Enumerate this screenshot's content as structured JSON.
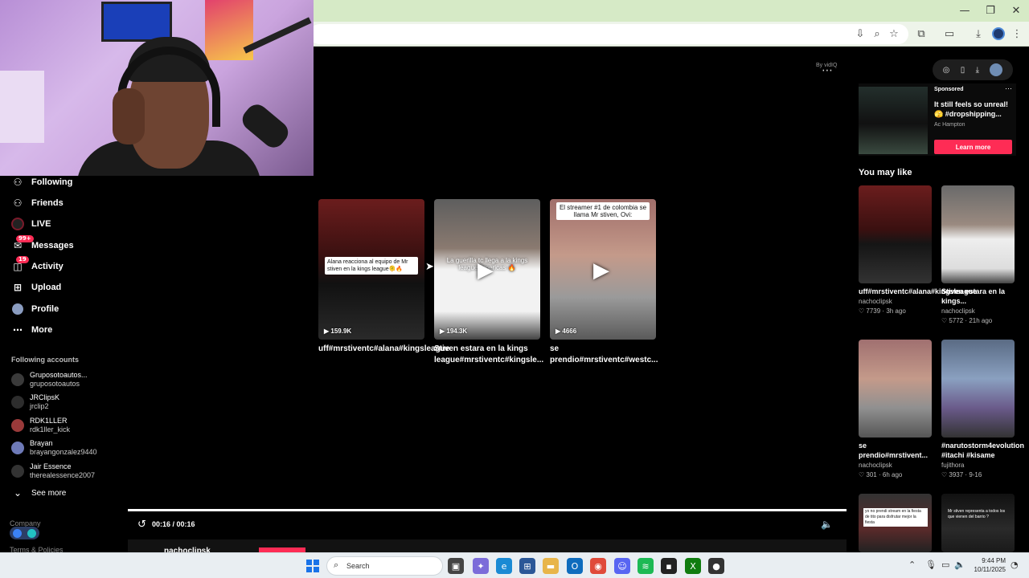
{
  "browser": {
    "window_controls": [
      "—",
      "❐",
      "✕"
    ],
    "toolbar_icons": [
      "install-icon",
      "zoom-icon",
      "star-icon",
      "extensions-icon",
      "cast-icon",
      "download-icon",
      "profile-icon",
      "menu-icon"
    ]
  },
  "sidebar": {
    "nav": [
      {
        "label": "Following",
        "icon": "following-icon"
      },
      {
        "label": "Friends",
        "icon": "friends-icon"
      },
      {
        "label": "LIVE",
        "icon": "live-icon"
      },
      {
        "label": "Messages",
        "icon": "messages-icon",
        "badge": "99+"
      },
      {
        "label": "Activity",
        "icon": "activity-icon",
        "badge": "19"
      },
      {
        "label": "Upload",
        "icon": "upload-icon"
      },
      {
        "label": "Profile",
        "icon": "profile-avatar"
      },
      {
        "label": "More",
        "icon": "more-icon"
      }
    ],
    "following_title": "Following accounts",
    "accounts": [
      {
        "name": "Gruposotoautos...",
        "handle": "gruposotoautos"
      },
      {
        "name": "JRClipsK",
        "handle": "jrclip2"
      },
      {
        "name": "RDK1LLER",
        "handle": "rdk1ller_kick"
      },
      {
        "name": "Brayan",
        "handle": "brayangonzalez9440"
      },
      {
        "name": "Jair Essence",
        "handle": "therealessence2007"
      }
    ],
    "see_more": "See more",
    "footer": {
      "company": "Company",
      "terms": "Terms & Policies"
    }
  },
  "main": {
    "byline": "By vidIQ",
    "videos": [
      {
        "title": "uff#mrstiventc#alana#kingsleague",
        "views": "159.9K",
        "caption": "Alana reacciona al equipo de Mr stiven en la kings league🫠🔥"
      },
      {
        "title": "Stiven estara en la kings league#mrstiventc#kingsle...",
        "views": "194.3K",
        "caption": "La guerilla tc llega a la kings league Americas 🔥"
      },
      {
        "title": "se prendio#mrstiventc#westc...",
        "views": "4666",
        "caption": "El streamer #1 de colombia se llama Mr stiven, Ovi:"
      }
    ],
    "player": {
      "time": "00:16 / 00:16",
      "progress": 1.0
    },
    "bottom_user": "nachoclipsk"
  },
  "right": {
    "ad": {
      "label": "Sponsored",
      "title": "It still feels so unreal! 🫣 #dropshipping...",
      "author": "Ac Hampton",
      "cta": "Learn more"
    },
    "you_may_like": "You may like",
    "cards": [
      {
        "title": "uff#mrstiventc#alana#kingsleague",
        "author": "nachoclipsk",
        "likes": "7739",
        "age": "3h ago"
      },
      {
        "title": "Stiven estara en la kings...",
        "author": "nachoclipsk",
        "likes": "5772",
        "age": "21h ago"
      },
      {
        "title": "se prendio#mrstivent...",
        "author": "nachoclipsk",
        "likes": "301",
        "age": "6h ago"
      },
      {
        "title": "#narutostorm4evolution #itachi #kisame",
        "author": "fujithora",
        "likes": "3937",
        "age": "9-16"
      },
      {
        "title": "",
        "author": "",
        "likes": "",
        "age": "",
        "caption": "yo no prendi stream en la fiesta de tito para disfrutar mejor la fiesta"
      },
      {
        "title": "",
        "author": "",
        "likes": "",
        "age": "",
        "caption": "Mr stiven representa a todos los que vienen del barrio ?"
      }
    ]
  },
  "taskbar": {
    "search_placeholder": "Search",
    "time": "9:44 PM",
    "date": "10/11/2025"
  },
  "colors": {
    "accent": "#fe2c55",
    "browser_frame": "#d6eac6",
    "background": "#000000"
  }
}
